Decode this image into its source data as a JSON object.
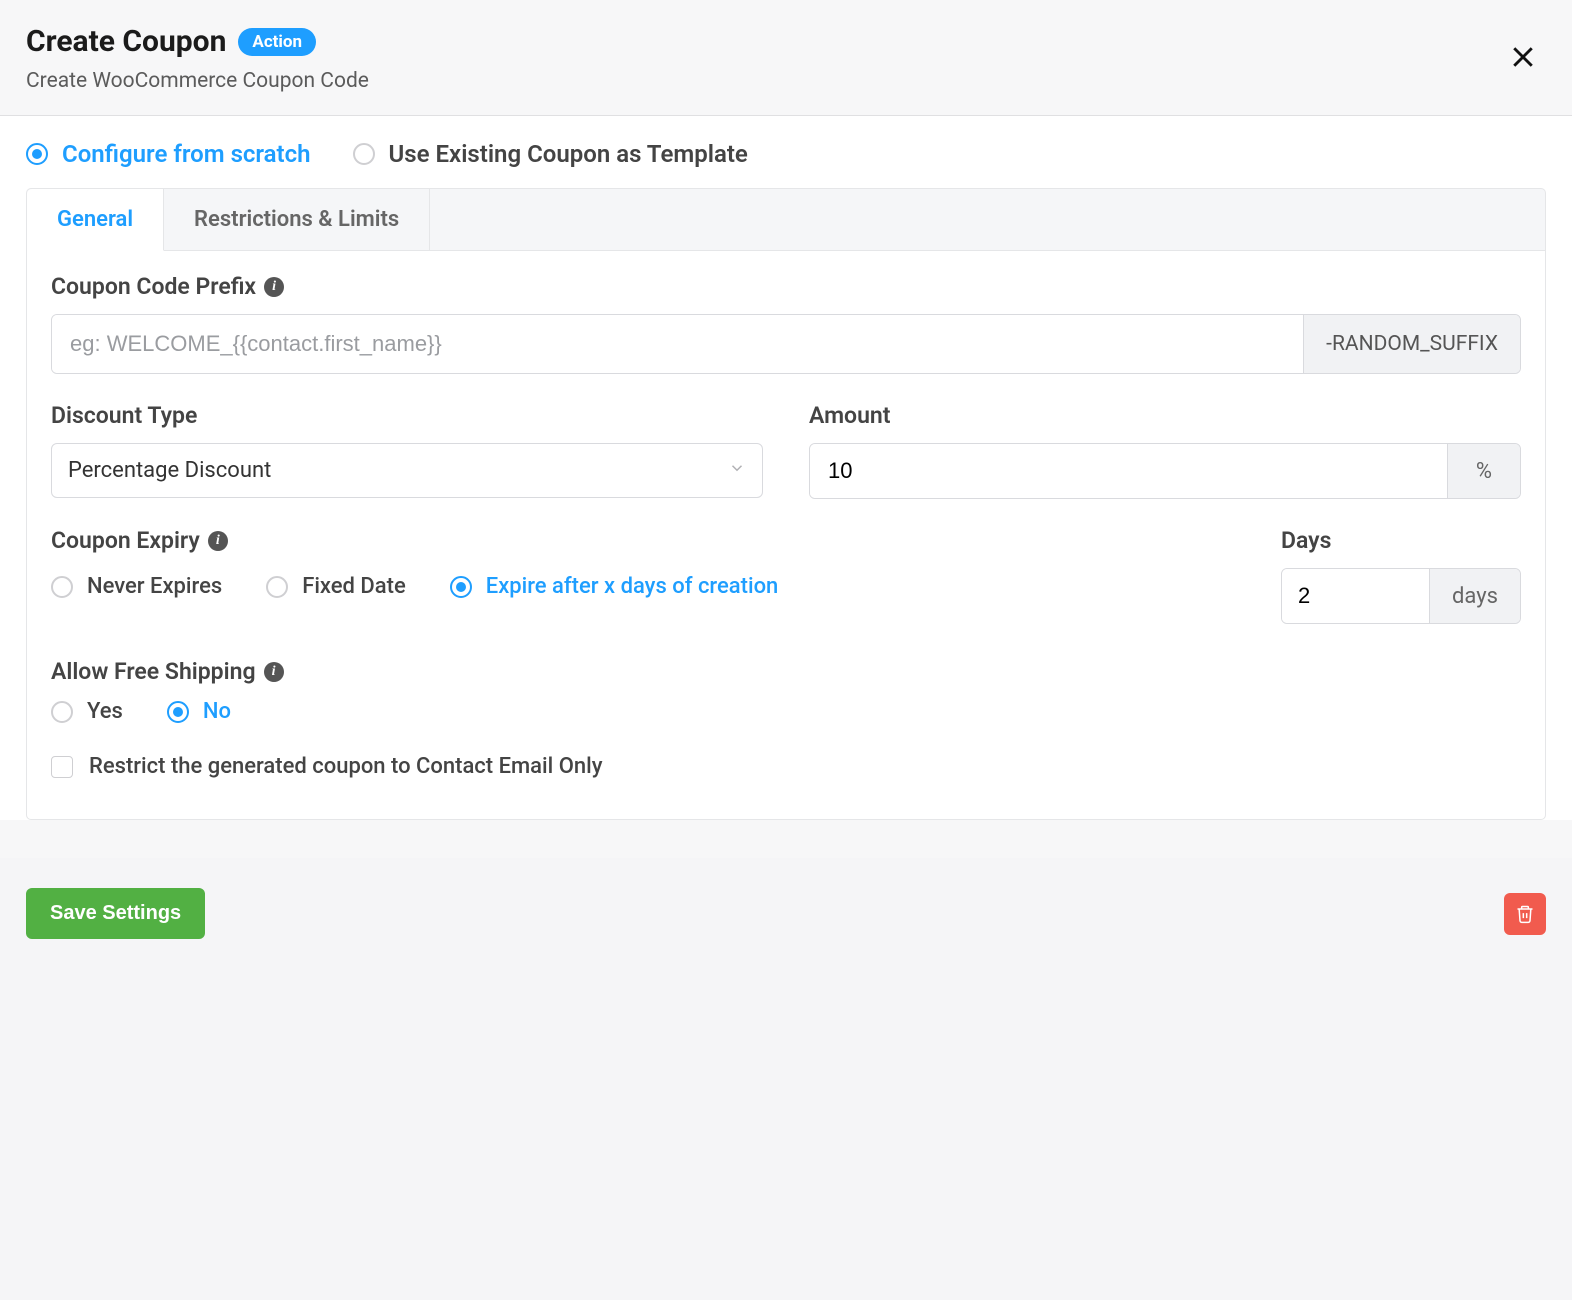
{
  "header": {
    "title": "Create Coupon",
    "badge": "Action",
    "subtitle": "Create WooCommerce Coupon Code"
  },
  "mode": {
    "scratch": "Configure from scratch",
    "template": "Use Existing Coupon as Template"
  },
  "tabs": {
    "general": "General",
    "restrictions": "Restrictions & Limits"
  },
  "prefix": {
    "label": "Coupon Code Prefix",
    "placeholder": "eg: WELCOME_{{contact.first_name}}",
    "suffix": "-RANDOM_SUFFIX"
  },
  "discount": {
    "type_label": "Discount Type",
    "type_value": "Percentage Discount",
    "amount_label": "Amount",
    "amount_value": "10",
    "amount_suffix": "%"
  },
  "expiry": {
    "label": "Coupon Expiry",
    "never": "Never Expires",
    "fixed": "Fixed Date",
    "after": "Expire after x days of creation",
    "days_label": "Days",
    "days_value": "2",
    "days_suffix": "days"
  },
  "shipping": {
    "label": "Allow Free Shipping",
    "yes": "Yes",
    "no": "No"
  },
  "restrict_email": "Restrict the generated coupon to Contact Email Only",
  "footer": {
    "save": "Save Settings"
  }
}
